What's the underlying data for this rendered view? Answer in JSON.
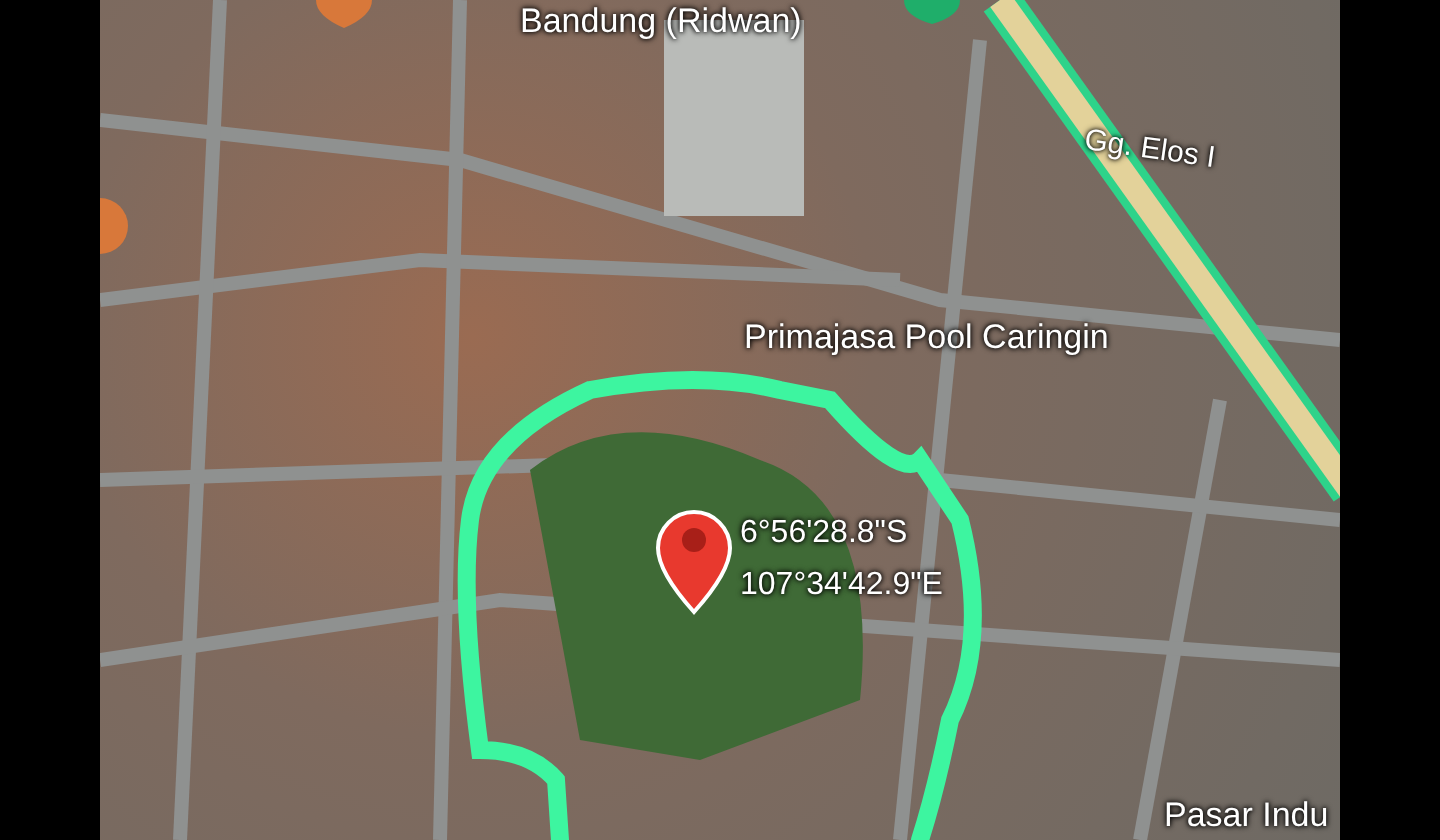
{
  "map": {
    "labels": [
      {
        "kind": "place",
        "text": "Bandung (Ridwan)"
      },
      {
        "kind": "street",
        "text": "Gg. Elos I"
      },
      {
        "kind": "place",
        "text": "Primajasa Pool Caringin"
      },
      {
        "kind": "place",
        "text": "Pasar Indu"
      }
    ],
    "pin": {
      "latitude": "6°56'28.8\"S",
      "longitude": "107°34'42.9\"E"
    }
  }
}
